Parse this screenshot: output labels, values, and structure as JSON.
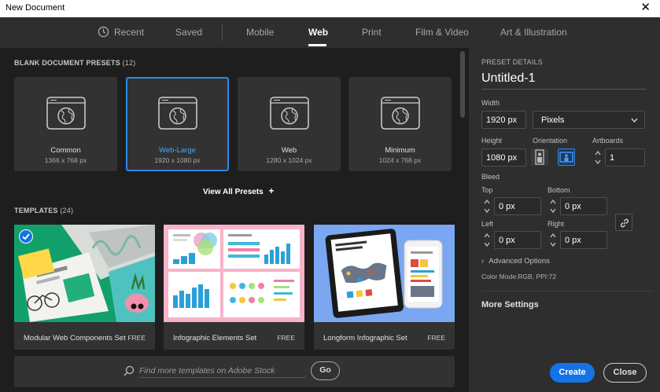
{
  "window": {
    "title": "New Document",
    "close_glyph": "✕"
  },
  "tabs": [
    {
      "label": "Recent",
      "icon": "clock-icon"
    },
    {
      "label": "Saved"
    },
    {
      "label": "Mobile"
    },
    {
      "label": "Web",
      "active": true
    },
    {
      "label": "Print"
    },
    {
      "label": "Film & Video"
    },
    {
      "label": "Art & Illustration"
    }
  ],
  "presets_section": {
    "title": "BLANK DOCUMENT PRESETS",
    "count": "(12)"
  },
  "presets": [
    {
      "name": "Common",
      "size": "1366 x 768 px",
      "icon": "web-document-icon"
    },
    {
      "name": "Web-Large",
      "size": "1920 x 1080 px",
      "selected": true,
      "icon": "web-document-icon"
    },
    {
      "name": "Web",
      "size": "1280 x 1024 px",
      "icon": "web-document-icon"
    },
    {
      "name": "Minimum",
      "size": "1024 x 768 px",
      "icon": "web-document-icon"
    }
  ],
  "view_all": {
    "label": "View All Presets",
    "icon": "plus-icon"
  },
  "templates_section": {
    "title": "TEMPLATES",
    "count": "(24)"
  },
  "templates": [
    {
      "name": "Modular Web Components Set",
      "price": "FREE",
      "checked": true
    },
    {
      "name": "Infographic Elements Set",
      "price": "FREE"
    },
    {
      "name": "Longform Infographic Set",
      "price": "FREE"
    }
  ],
  "search": {
    "placeholder": "Find more templates on Adobe Stock",
    "go_label": "Go"
  },
  "details": {
    "heading": "PRESET DETAILS",
    "doc_name": "Untitled-1",
    "width_label": "Width",
    "width_value": "1920 px",
    "units": "Pixels",
    "height_label": "Height",
    "height_value": "1080 px",
    "orientation_label": "Orientation",
    "artboards_label": "Artboards",
    "artboards_value": "1",
    "bleed_label": "Bleed",
    "top_label": "Top",
    "top_value": "0 px",
    "bottom_label": "Bottom",
    "bottom_value": "0 px",
    "left_label": "Left",
    "left_value": "0 px",
    "right_label": "Right",
    "right_value": "0 px",
    "advanced_label": "Advanced Options",
    "color_mode": "Color Mode:RGB, PPI:72",
    "more_settings": "More Settings",
    "create_label": "Create",
    "close_label": "Close"
  },
  "colors": {
    "accent": "#1473e6",
    "selection": "#2d88e6",
    "panel": "#2e2e2e"
  }
}
